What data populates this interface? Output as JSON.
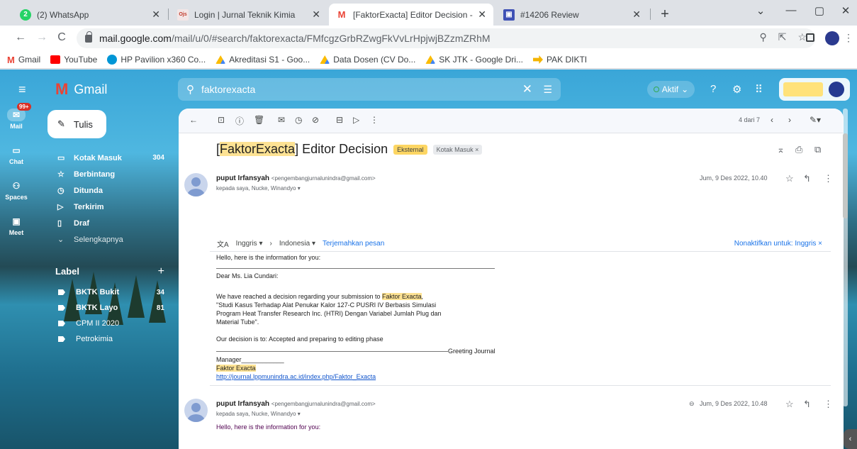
{
  "browser": {
    "tabs": [
      {
        "label": "(2) WhatsApp",
        "icon": "whatsapp-icon",
        "color": "#25d366",
        "badge": "2"
      },
      {
        "label": "Login | Jurnal Teknik Kimia",
        "icon": "ojs-icon",
        "color": "#c0392b",
        "badge": "Ojs"
      },
      {
        "label": "[FaktorExacta] Editor Decision - I",
        "icon": "gmail-icon",
        "color": "#ea4335",
        "badge": "M"
      },
      {
        "label": "#14206 Review",
        "icon": "ojs-review-icon",
        "color": "#3f51b5",
        "badge": "▣"
      }
    ],
    "new_tab": "+",
    "window_controls": [
      "⌄",
      "—",
      "▢",
      "✕"
    ],
    "url_host": "mail.google.com",
    "url_path": "/mail/u/0/#search/faktorexacta/FMfcgzGrbRZwgFkVvLrHpjwjBZzmZRhM",
    "bookmarks": [
      {
        "label": "Gmail",
        "icon": "gmail-icon",
        "color": "#ea4335"
      },
      {
        "label": "YouTube",
        "icon": "youtube-icon",
        "color": "#ff0000"
      },
      {
        "label": "HP Pavilion x360 Co...",
        "icon": "hp-icon",
        "color": "#0096d6"
      },
      {
        "label": "Akreditasi S1 - Goo...",
        "icon": "drive-icon",
        "color": "#fbbc04"
      },
      {
        "label": "Data Dosen (CV Do...",
        "icon": "drive-icon",
        "color": "#fbbc04"
      },
      {
        "label": "SK JTK - Google Dri...",
        "icon": "drive-icon",
        "color": "#fbbc04"
      },
      {
        "label": "PAK DIKTI",
        "icon": "pak-dikti-icon",
        "color": "#f4b400"
      }
    ]
  },
  "gmail": {
    "app_name": "Gmail",
    "search_query": "faktorexacta",
    "status": "Aktif",
    "rail": [
      {
        "label": "Mail",
        "badge": "99+",
        "icon": "mail-icon"
      },
      {
        "label": "Chat",
        "icon": "chat-icon"
      },
      {
        "label": "Spaces",
        "icon": "spaces-icon"
      },
      {
        "label": "Meet",
        "icon": "meet-icon"
      }
    ],
    "compose_label": "Tulis",
    "nav": [
      {
        "label": "Kotak Masuk",
        "count": "304",
        "icon": "inbox-icon"
      },
      {
        "label": "Berbintang",
        "count": "",
        "icon": "star-icon"
      },
      {
        "label": "Ditunda",
        "count": "",
        "icon": "clock-icon"
      },
      {
        "label": "Terkirim",
        "count": "",
        "icon": "send-icon"
      },
      {
        "label": "Draf",
        "count": "",
        "icon": "draft-icon"
      },
      {
        "label": "Selengkapnya",
        "count": "",
        "icon": "chevron-down-icon"
      }
    ],
    "labels_header": "Label",
    "labels": [
      {
        "label": "BKTK Bukit",
        "count": "34"
      },
      {
        "label": "BKTK Layo",
        "count": "81"
      },
      {
        "label": "CPM II 2020",
        "count": ""
      },
      {
        "label": "Petrokimia",
        "count": ""
      }
    ],
    "pager": "4 dari 7"
  },
  "message": {
    "subject_prefix": "[",
    "subject_highlight": "FaktorExacta",
    "subject_rest": "] Editor Decision",
    "tag_external": "Eksternal",
    "tag_inbox": "Kotak Masuk ×",
    "sender_name": "puput Irfansyah",
    "sender_email": "<pengembangjurnalunindra@gmail.com>",
    "recipients": "kepada saya, Nucke, Winandyo ▾",
    "date": "Jum, 9 Des 2022, 10.40",
    "translate": {
      "from": "Inggris ▾",
      "to": "Indonesia ▾",
      "action": "Terjemahkan pesan",
      "off": "Nonaktifkan untuk: Inggris ×"
    },
    "greeting": "Hello, here is the information for you:",
    "dear": "Dear Ms. Lia Cundari:",
    "line1_pre": "We have reached a decision regarding your submission to",
    "line1_hl": "Faktor Exacta",
    "line1_post": ",",
    "title_lines": [
      "\"Studi Kasus Terhadap Alat Penukar Kalor 127-C PUSRI IV Berbasis Simulasi",
      "Program Heat Transfer Research Inc. (HTRI) Dengan Variabel Jumlah Plug dan",
      "Material Tube\"."
    ],
    "decision": "Our decision is to: Accepted and preparing to editing phase",
    "greeting_journal": "Greeting Journal",
    "manager": "Manager____________",
    "signature_hl": "Faktor Exacta",
    "link": "http://journal.lppmunindra.ac.id/index.php/Faktor_Exacta"
  },
  "message2": {
    "sender_name": "puput Irfansyah",
    "sender_email": "<pengembangjurnalunindra@gmail.com>",
    "recipients": "kepada saya, Nucke, Winandyo ▾",
    "date": "Jum, 9 Des 2022, 10.48",
    "preview": "Hello, here is the information for you:"
  }
}
